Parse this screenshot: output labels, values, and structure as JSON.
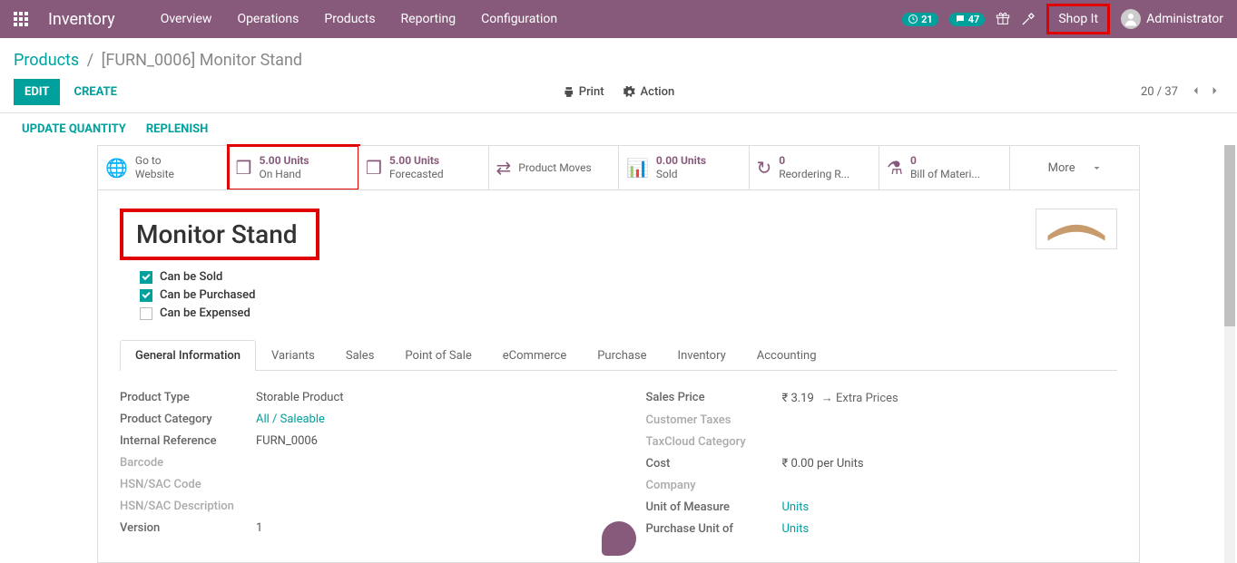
{
  "navbar": {
    "brand": "Inventory",
    "menu": [
      "Overview",
      "Operations",
      "Products",
      "Reporting",
      "Configuration"
    ],
    "badge1": "21",
    "badge2": "47",
    "shop": "Shop It",
    "user": "Administrator"
  },
  "breadcrumb": {
    "root": "Products",
    "current": "[FURN_0006] Monitor Stand"
  },
  "buttons": {
    "edit": "EDIT",
    "create": "CREATE",
    "print": "Print",
    "action": "Action"
  },
  "pager": {
    "pos": "20 / 37"
  },
  "subactions": {
    "update_qty": "UPDATE QUANTITY",
    "replenish": "REPLENISH"
  },
  "stats": {
    "website": {
      "l1": "Go to",
      "l2": "Website"
    },
    "onhand": {
      "val": "5.00 Units",
      "lbl": "On Hand"
    },
    "forecast": {
      "val": "5.00 Units",
      "lbl": "Forecasted"
    },
    "moves": {
      "lbl": "Product Moves"
    },
    "sold": {
      "val": "0.00 Units",
      "lbl": "Sold"
    },
    "reorder": {
      "val": "0",
      "lbl": "Reordering R..."
    },
    "bom": {
      "val": "0",
      "lbl": "Bill of Materi..."
    },
    "more": "More"
  },
  "product": {
    "name": "Monitor Stand",
    "can_sold": "Can be Sold",
    "can_purchased": "Can be Purchased",
    "can_expensed": "Can be Expensed"
  },
  "tabs": [
    "General Information",
    "Variants",
    "Sales",
    "Point of Sale",
    "eCommerce",
    "Purchase",
    "Inventory",
    "Accounting"
  ],
  "fields_left": {
    "product_type": {
      "label": "Product Type",
      "value": "Storable Product"
    },
    "category": {
      "label": "Product Category",
      "value": "All / Saleable"
    },
    "internal_ref": {
      "label": "Internal Reference",
      "value": "FURN_0006"
    },
    "barcode": {
      "label": "Barcode",
      "value": ""
    },
    "hsn_code": {
      "label": "HSN/SAC Code",
      "value": ""
    },
    "hsn_desc": {
      "label": "HSN/SAC Description",
      "value": ""
    },
    "version": {
      "label": "Version",
      "value": "1"
    }
  },
  "fields_right": {
    "sales_price": {
      "label": "Sales Price",
      "value": "₹ 3.19",
      "extra": "Extra Prices"
    },
    "cust_tax": {
      "label": "Customer Taxes",
      "value": ""
    },
    "taxcloud": {
      "label": "TaxCloud Category",
      "value": ""
    },
    "cost": {
      "label": "Cost",
      "value": "₹ 0.00",
      "suffix": "per Units"
    },
    "company": {
      "label": "Company",
      "value": ""
    },
    "uom": {
      "label": "Unit of Measure",
      "value": "Units"
    },
    "puom": {
      "label": "Purchase Unit of",
      "value": "Units"
    }
  }
}
